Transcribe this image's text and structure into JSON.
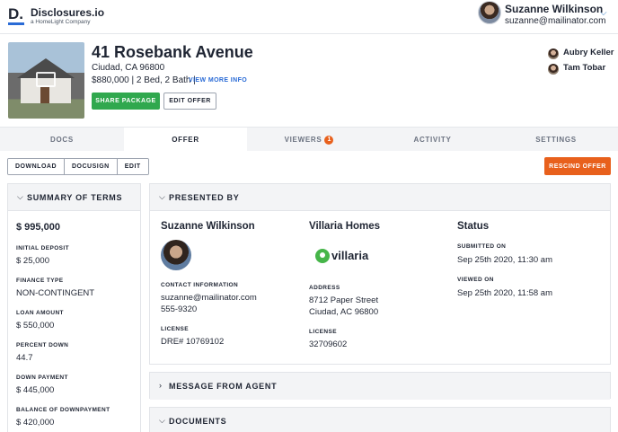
{
  "brand": {
    "mark": "D.",
    "name": "Disclosures.io",
    "tagline": "a HomeLight Company"
  },
  "user": {
    "name": "Suzanne Wilkinson",
    "email": "suzanne@mailinator.com"
  },
  "property": {
    "title": "41 Rosebank Avenue",
    "city": "Ciudad, CA 96800",
    "details": "$880,000 | 2 Bed, 2 Bath |",
    "view_more": "VIEW MORE INFO",
    "share_label": "SHARE PACKAGE",
    "edit_offer_label": "EDIT OFFER",
    "agents": [
      "Aubry Keller",
      "Tam Tobar"
    ]
  },
  "tabs": [
    {
      "label": "DOCS"
    },
    {
      "label": "OFFER"
    },
    {
      "label": "VIEWERS",
      "badge": "1"
    },
    {
      "label": "ACTIVITY"
    },
    {
      "label": "SETTINGS"
    }
  ],
  "actions": {
    "download": "DOWNLOAD",
    "docusign": "DOCUSIGN",
    "edit": "EDIT",
    "rescind": "RESCIND OFFER"
  },
  "summary": {
    "title": "SUMMARY OF TERMS",
    "price": "$ 995,000",
    "items": [
      {
        "label": "INITIAL DEPOSIT",
        "value": "$ 25,000"
      },
      {
        "label": "FINANCE TYPE",
        "value": "NON-CONTINGENT"
      },
      {
        "label": "LOAN AMOUNT",
        "value": "$ 550,000"
      },
      {
        "label": "PERCENT DOWN",
        "value": "44.7"
      },
      {
        "label": "DOWN PAYMENT",
        "value": "$ 445,000"
      },
      {
        "label": "BALANCE OF DOWNPAYMENT",
        "value": "$ 420,000"
      }
    ]
  },
  "presented_by": {
    "title": "PRESENTED BY",
    "agent": {
      "name": "Suzanne Wilkinson",
      "contact_label": "CONTACT INFORMATION",
      "email": "suzanne@mailinator.com",
      "phone": "555-9320",
      "license_label": "LICENSE",
      "license": "DRE# 10769102"
    },
    "brokerage": {
      "name": "Villaria Homes",
      "logo_text": "villaria",
      "address_label": "ADDRESS",
      "address_line1": "8712 Paper Street",
      "address_line2": "Ciudad, AC 96800",
      "license_label": "LICENSE",
      "license": "32709602"
    },
    "status": {
      "title": "Status",
      "submitted_label": "SUBMITTED ON",
      "submitted": "Sep 25th 2020, 11:30 am",
      "viewed_label": "VIEWED ON",
      "viewed": "Sep 25th 2020, 11:58 am"
    }
  },
  "message": {
    "title": "MESSAGE FROM AGENT"
  },
  "documents": {
    "title": "DOCUMENTS"
  },
  "icons": {
    "chevron_down": "chevron-down-icon",
    "chevron_right": "chevron-right-icon",
    "gallery": "image-gallery-icon"
  },
  "colors": {
    "accent_blue": "#2a6bd6",
    "share_green": "#30a84e",
    "rescind_orange": "#e8601c",
    "villaria_green": "#46b549"
  }
}
